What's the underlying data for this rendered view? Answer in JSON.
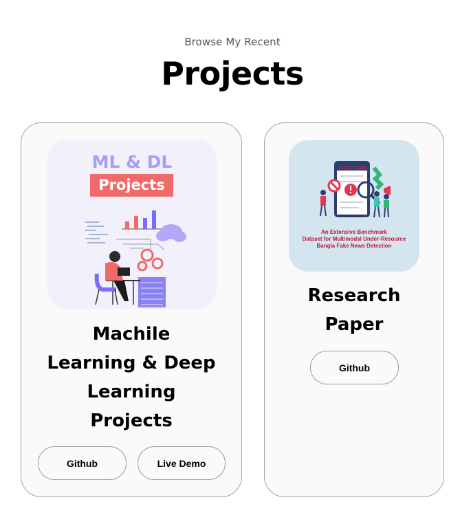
{
  "header": {
    "subtitle": "Browse My Recent",
    "title": "Projects"
  },
  "projects": [
    {
      "title_lines": [
        "Machile",
        "Learning & Deep",
        "Learning",
        "Projects"
      ],
      "image": {
        "heading": "ML & DL",
        "badge": "Projects",
        "accent_color": "#a99cf7",
        "badge_color": "#f06a6a",
        "icon": "ml-illustration"
      },
      "buttons": [
        {
          "label": "Github"
        },
        {
          "label": "Live Demo"
        }
      ]
    },
    {
      "title_lines": [
        "Research",
        "Paper"
      ],
      "image": {
        "tag": "FAKE NEWS",
        "caption_lines": [
          "An Extensive Benchmark",
          "Dataset for Multimodal Under-Resource",
          "Bangla Fake News Detection"
        ],
        "caption_color": "#c4123c",
        "icon": "fake-news-illustration"
      },
      "buttons": [
        {
          "label": "Github"
        }
      ]
    }
  ]
}
